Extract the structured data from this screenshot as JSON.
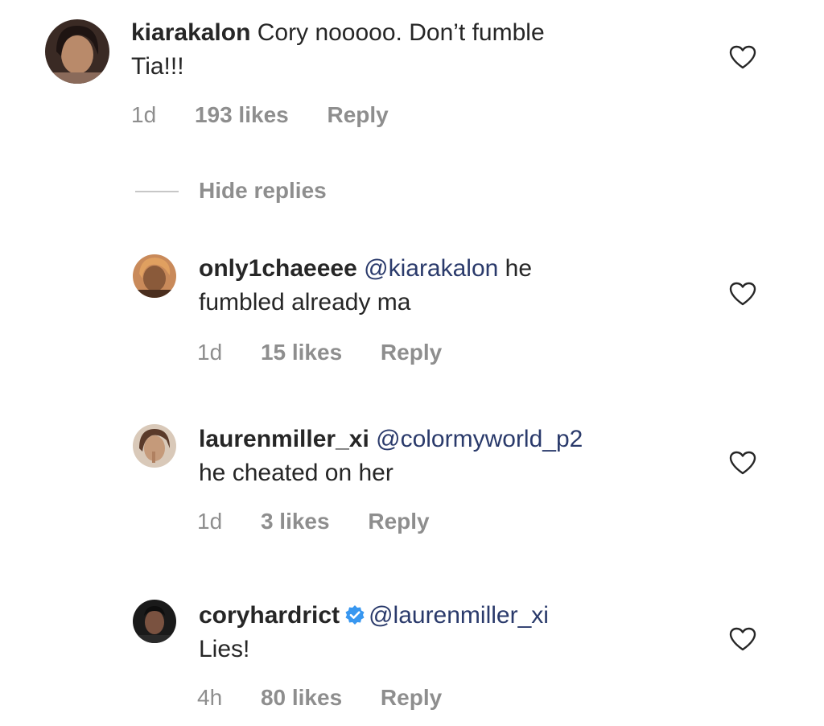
{
  "colors": {
    "text": "#262626",
    "muted": "#8e8e8e",
    "mention": "#2a3a6b",
    "verified": "#3897f0",
    "divider": "#c7c7c7"
  },
  "comment": {
    "username": "kiarakalon",
    "text_line1": "Cory nooooo. Don’t fumble",
    "text_line2": "Tia!!!",
    "time": "1d",
    "likes": "193 likes",
    "reply": "Reply",
    "avatar_icon": "profile-photo",
    "like_icon": "heart-outline-icon"
  },
  "thread": {
    "hide_replies": "Hide replies"
  },
  "replies": [
    {
      "username": "only1chaeeee",
      "mention": "@kiarakalon",
      "text_after_mention": " he",
      "text_line2": "fumbled already ma",
      "time": "1d",
      "likes": "15 likes",
      "reply": "Reply",
      "verified": false
    },
    {
      "username": "laurenmiller_xi",
      "mention": "@colormyworld_p2",
      "text_after_mention": "",
      "text_line2": "he cheated on her",
      "time": "1d",
      "likes": "3 likes",
      "reply": "Reply",
      "verified": false
    },
    {
      "username": "coryhardrict",
      "mention": "@laurenmiller_xi",
      "text_after_mention": "",
      "text_line2": "Lies!",
      "time": "4h",
      "likes": "80 likes",
      "reply": "Reply",
      "verified": true,
      "badge_icon": "verified-badge-icon"
    }
  ]
}
